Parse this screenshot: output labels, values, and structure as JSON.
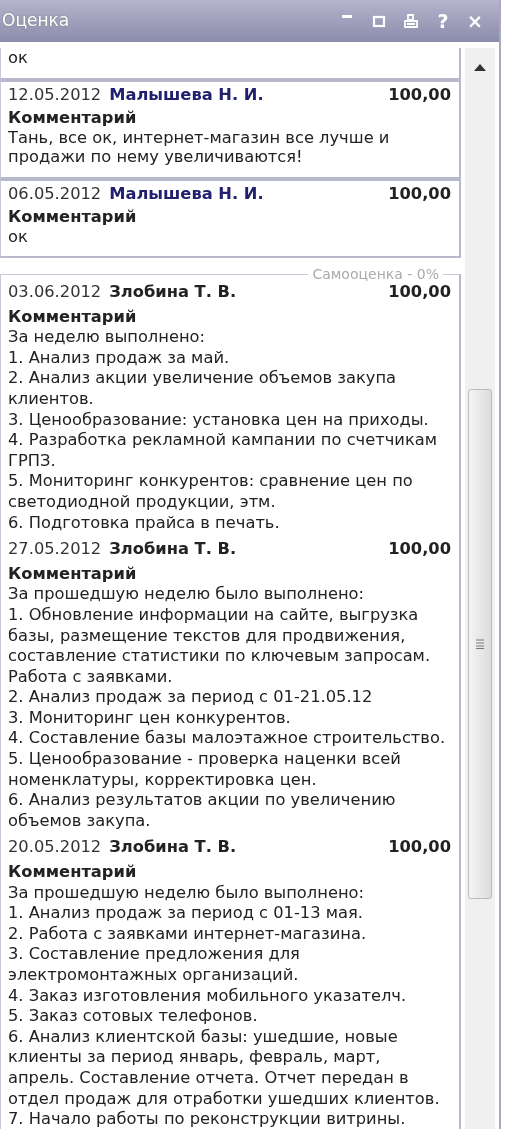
{
  "window": {
    "title": "Оценка",
    "buttons": [
      {
        "kind": "minimize"
      },
      {
        "kind": "maximize"
      },
      {
        "kind": "print"
      },
      {
        "kind": "help",
        "label": "?"
      },
      {
        "kind": "close",
        "label": "×"
      }
    ]
  },
  "sections": [
    {
      "kind": "manager",
      "entries": [
        {
          "comment": "ок"
        },
        {
          "date": "12.05.2012",
          "author": "Малышева Н. И.",
          "score": "100,00",
          "comment_label": "Комментарий",
          "comment": "Тань, все ок, интернет-магазин все лучше и продажи по нему увеличиваются!"
        },
        {
          "date": "06.05.2012",
          "author": "Малышева Н. И.",
          "score": "100,00",
          "comment_label": "Комментарий",
          "comment": "ок"
        }
      ]
    },
    {
      "kind": "self",
      "legend": "Самооценка - 0%",
      "entries": [
        {
          "date": "03.06.2012",
          "author": "Злобина Т. В.",
          "score": "100,00",
          "comment_label": "Комментарий",
          "comment": "За неделю выполнено:\n1. Анализ продаж за май.\n2. Анализ акции увеличение объемов закупа клиентов.\n3. Ценообразование: установка цен на приходы.\n4. Разработка рекламной кампании по счетчикам ГРПЗ.\n5. Мониторинг конкурентов: сравнение цен по светодиодной продукции, этм.\n6. Подготовка прайса в печать."
        },
        {
          "date": "27.05.2012",
          "author": "Злобина Т. В.",
          "score": "100,00",
          "comment_label": "Комментарий",
          "comment": "За прошедшую неделю было выполнено:\n1. Обновление информации на сайте, выгрузка базы, размещение текстов для продвижения, составление статистики по ключевым запросам. Работа с заявками.\n2. Анализ продаж за период с 01-21.05.12\n3. Мониторинг цен конкурентов.\n4. Составление базы малоэтажное строительство.\n5. Ценообразование - проверка наценки всей номенклатуры, корректировка цен.\n6. Анализ результатов акции по увеличению объемов закупа."
        },
        {
          "date": "20.05.2012",
          "author": "Злобина Т. В.",
          "score": "100,00",
          "comment_label": "Комментарий",
          "comment": "За прошедшую неделю было выполнено:\n1. Анализ продаж за период с 01-13 мая.\n2. Работа с заявками интернет-магазина.\n3. Составление предложения для электромонтажных организаций.\n4. Заказ изготовления мобильного указателч.\n5. Заказ сотовых телефонов.\n6. Анализ клиентской базы: ушедшие, новые клиенты за период январь, февраль, март, апрель. Составление отчета. Отчет передан в отдел продаж для отработки ушедших клиентов.\n7. Начало работы по реконструкции витрины."
        }
      ]
    }
  ]
}
